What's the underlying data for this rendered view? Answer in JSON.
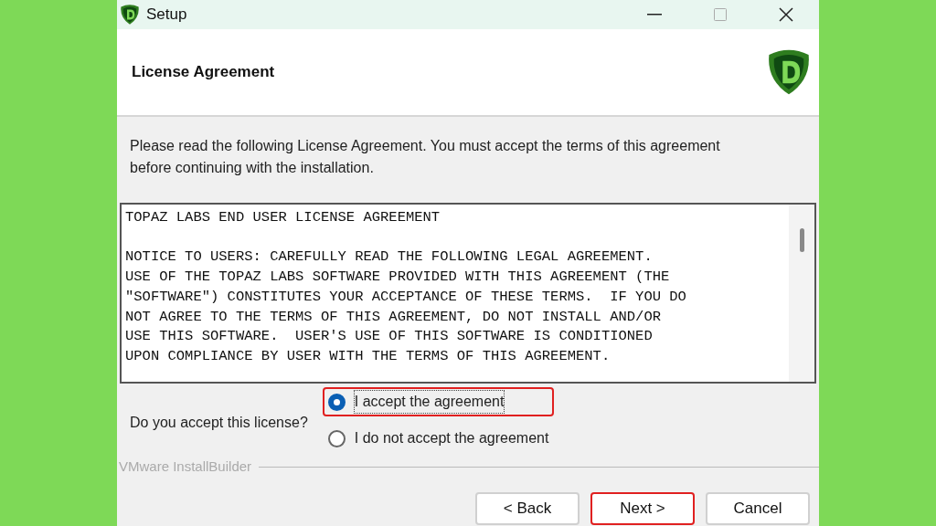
{
  "window": {
    "title": "Setup"
  },
  "header": {
    "title": "License Agreement"
  },
  "intro": "Please read the following License Agreement. You must accept the terms of this agreement before continuing with the installation.",
  "license_title": "TOPAZ LABS END USER LICENSE AGREEMENT",
  "license_lines": [
    "NOTICE TO USERS: CAREFULLY READ THE FOLLOWING LEGAL AGREEMENT.",
    "USE OF THE TOPAZ LABS SOFTWARE PROVIDED WITH THIS AGREEMENT (THE",
    "\"SOFTWARE\") CONSTITUTES YOUR ACCEPTANCE OF THESE TERMS.  IF YOU DO",
    "NOT AGREE TO THE TERMS OF THIS AGREEMENT, DO NOT INSTALL AND/OR",
    "USE THIS SOFTWARE.  USER'S USE OF THIS SOFTWARE IS CONDITIONED",
    "UPON COMPLIANCE BY USER WITH THE TERMS OF THIS AGREEMENT."
  ],
  "question": "Do you accept this license?",
  "options": [
    {
      "label": "I accept the agreement",
      "selected": true,
      "highlighted": true
    },
    {
      "label": "I do not accept the agreement",
      "selected": false,
      "highlighted": false
    }
  ],
  "footer_label": "VMware InstallBuilder",
  "buttons": [
    {
      "label": "< Back",
      "highlighted": false
    },
    {
      "label": "Next >",
      "highlighted": true
    },
    {
      "label": "Cancel",
      "highlighted": false
    }
  ]
}
